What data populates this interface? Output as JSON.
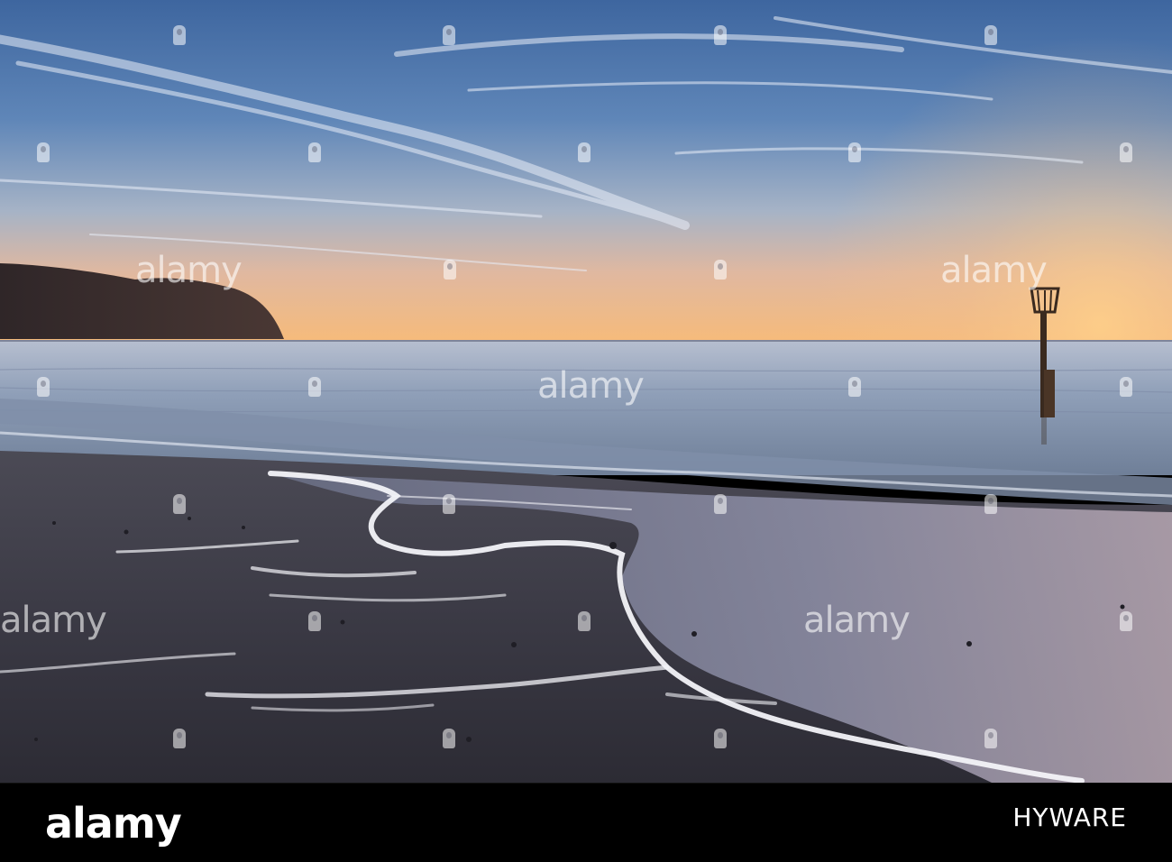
{
  "watermark": {
    "text": "alamy"
  },
  "footer": {
    "logo_text": "alamy",
    "image_id": "HYWARE",
    "background_color": "#000000",
    "text_color": "#ffffff"
  },
  "scene": {
    "sky_top_color": "#3f6aa3",
    "sky_horizon_color": "#f3b879",
    "sea_color": "#9db0c8",
    "sand_color": "#3a3944",
    "foam_color": "#f2f2f7",
    "post_color": "#3a2a1f",
    "headland_color": "#3c2f2d"
  }
}
